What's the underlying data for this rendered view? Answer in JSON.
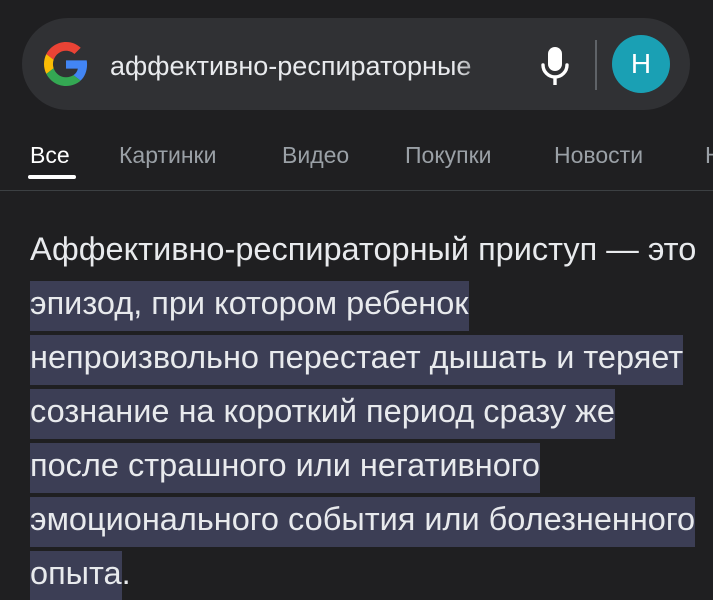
{
  "search": {
    "query": "аффективно-респираторные"
  },
  "user": {
    "avatar_initial": "Н"
  },
  "tabs": [
    {
      "label": "Все",
      "active": true
    },
    {
      "label": "Картинки",
      "active": false
    },
    {
      "label": "Видео",
      "active": false
    },
    {
      "label": "Покупки",
      "active": false
    },
    {
      "label": "Новости",
      "active": false
    },
    {
      "label": "Н",
      "active": false
    }
  ],
  "snippet": {
    "intro": "Аффективно-респираторный приступ — это ",
    "highlighted": "эпизод, при котором ребенок непроизвольно перестает дышать и теряет сознание на короткий период сразу же после страшного или негативного эмоционального события или болезненного опыта",
    "end": "."
  },
  "colors": {
    "background": "#1f1f21",
    "search_bar": "#303134",
    "highlight": "#3c3e55",
    "avatar": "#1aa0b4",
    "mic": "#ffffff"
  },
  "icons": {
    "logo": "google-g-icon",
    "mic": "microphone-icon"
  }
}
